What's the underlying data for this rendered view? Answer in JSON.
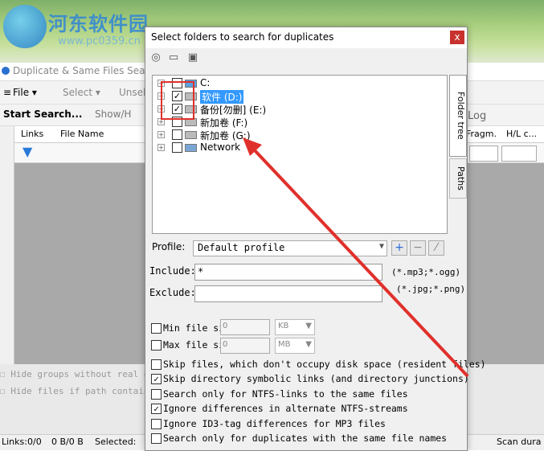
{
  "watermark": {
    "brand": "河东软件园",
    "url": "www.pc0359.cn"
  },
  "app": {
    "title": "Duplicate & Same Files Sear",
    "menu": {
      "file": "File ▾",
      "select": "Select ▾",
      "unsel": "Unsel"
    },
    "toolbar": {
      "start_search": "Start Search...",
      "show": "Show/H"
    },
    "grid_headers": {
      "links": "Links",
      "file_name": "File Name",
      "fragm": "Fragm.",
      "hl": "H/L c..."
    },
    "log_tab": "Log",
    "bottom_options": [
      "Hide groups without real dupl",
      "Hide files if path contains"
    ],
    "status": {
      "label_links": "Links:",
      "links": "0/0",
      "size": "0 B/0 B",
      "selected": "Selected:",
      "scan": "Scan dura"
    }
  },
  "dialog": {
    "title": "Select folders to search for duplicates",
    "close": "x",
    "tree": [
      {
        "label": "C:",
        "checked": false,
        "selected": false
      },
      {
        "label": "软件 (D:)",
        "checked": true,
        "selected": true
      },
      {
        "label": "备份[勿删] (E:)",
        "checked": true,
        "selected": false
      },
      {
        "label": "新加卷 (F:)",
        "checked": false,
        "selected": false
      },
      {
        "label": "新加卷 (G:)",
        "checked": false,
        "selected": false
      },
      {
        "label": "Network",
        "checked": false,
        "selected": false
      }
    ],
    "tabs": {
      "folder_tree": "Folder tree",
      "paths": "Paths"
    },
    "profile": {
      "label": "Profile:",
      "value": "Default profile"
    },
    "include": {
      "label": "Include:",
      "value": "*",
      "hint": "(*.mp3;*.ogg)"
    },
    "exclude": {
      "label": "Exclude:",
      "value": "",
      "hint": "(*.jpg;*.png)"
    },
    "min_size": {
      "label": "Min file siz",
      "value": "0",
      "unit": "KB"
    },
    "max_size": {
      "label": "Max file siz",
      "value": "0",
      "unit": "MB"
    },
    "options": [
      {
        "label": "Skip files, which don't occupy disk space (resident files)",
        "checked": false
      },
      {
        "label": "Skip directory symbolic links (and directory junctions)",
        "checked": true
      },
      {
        "label": "Search only for NTFS-links to the same files",
        "checked": false
      },
      {
        "label": "Ignore differences in alternate NTFS-streams",
        "checked": true
      },
      {
        "label": "Ignore ID3-tag differences for MP3 files",
        "checked": false
      },
      {
        "label": "Search only for duplicates with the same file names",
        "checked": false
      }
    ]
  }
}
